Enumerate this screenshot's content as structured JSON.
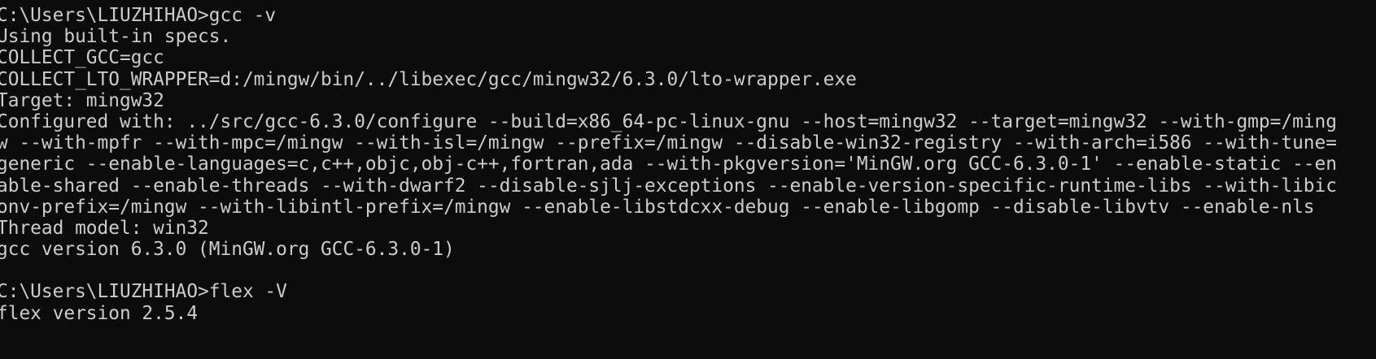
{
  "terminal": {
    "lines": [
      "C:\\Users\\LIUZHIHAO>gcc -v",
      "Using built-in specs.",
      "COLLECT_GCC=gcc",
      "COLLECT_LTO_WRAPPER=d:/mingw/bin/../libexec/gcc/mingw32/6.3.0/lto-wrapper.exe",
      "Target: mingw32",
      "Configured with: ../src/gcc-6.3.0/configure --build=x86_64-pc-linux-gnu --host=mingw32 --target=mingw32 --with-gmp=/ming",
      "w --with-mpfr --with-mpc=/mingw --with-isl=/mingw --prefix=/mingw --disable-win32-registry --with-arch=i586 --with-tune=",
      "generic --enable-languages=c,c++,objc,obj-c++,fortran,ada --with-pkgversion='MinGW.org GCC-6.3.0-1' --enable-static --en",
      "able-shared --enable-threads --with-dwarf2 --disable-sjlj-exceptions --enable-version-specific-runtime-libs --with-libic",
      "onv-prefix=/mingw --with-libintl-prefix=/mingw --enable-libstdcxx-debug --enable-libgomp --disable-libvtv --enable-nls",
      "Thread model: win32",
      "gcc version 6.3.0 (MinGW.org GCC-6.3.0-1)",
      "",
      "C:\\Users\\LIUZHIHAO>flex -V",
      "flex version 2.5.4"
    ]
  },
  "colors": {
    "background": "#0c0c0c",
    "foreground": "#cccccc"
  }
}
